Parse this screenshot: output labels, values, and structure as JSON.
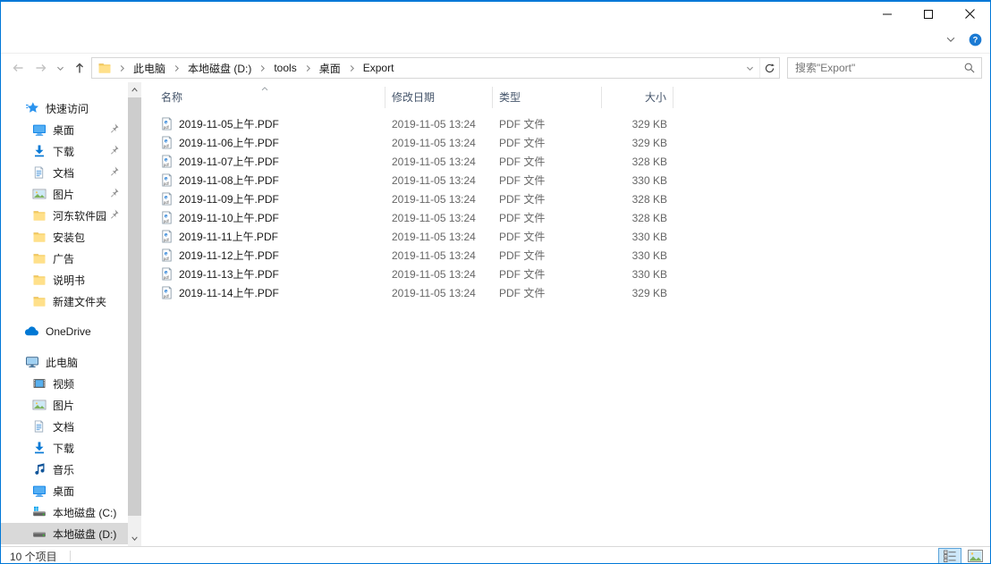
{
  "colors": {
    "accent": "#0078d7",
    "sidebar_selected": "#d9d9d9",
    "search_text": "#757575"
  },
  "titlebar": {
    "controls": [
      {
        "name": "minimize-button",
        "icon": "minimize-icon"
      },
      {
        "name": "maximize-button",
        "icon": "maximize-icon"
      },
      {
        "name": "close-button",
        "icon": "close-icon"
      }
    ]
  },
  "ribbon": {
    "buttons": [
      {
        "name": "ribbon-expand-button",
        "icon": "chevron-down-icon"
      },
      {
        "name": "help-button",
        "icon": "help-icon"
      }
    ]
  },
  "navbar": {
    "back_icon": "arrow-left-icon",
    "forward_icon": "arrow-right-icon",
    "recent_icon": "chevron-down-small-icon",
    "up_icon": "arrow-up-icon",
    "address": {
      "root_icon": "folder-icon",
      "segments": [
        "此电脑",
        "本地磁盘 (D:)",
        "tools",
        "桌面",
        "Export"
      ],
      "dropdown_icon": "chevron-down-small-icon",
      "refresh_icon": "refresh-icon"
    },
    "search": {
      "placeholder": "搜索\"Export\"",
      "icon": "search-icon"
    }
  },
  "sidebar": {
    "sections": [
      {
        "root": {
          "label": "快速访问",
          "icon": "quick-access-icon"
        },
        "children": [
          {
            "label": "桌面",
            "icon": "desktop-icon",
            "pinned": true
          },
          {
            "label": "下载",
            "icon": "download-icon",
            "pinned": true
          },
          {
            "label": "文档",
            "icon": "document-icon",
            "pinned": true
          },
          {
            "label": "图片",
            "icon": "picture-icon",
            "pinned": true
          },
          {
            "label": "河东软件园",
            "icon": "folder-icon",
            "pinned": true
          },
          {
            "label": "安装包",
            "icon": "folder-icon",
            "pinned": false
          },
          {
            "label": "广告",
            "icon": "folder-icon",
            "pinned": false
          },
          {
            "label": "说明书",
            "icon": "folder-icon",
            "pinned": false
          },
          {
            "label": "新建文件夹",
            "icon": "folder-icon",
            "pinned": false
          }
        ]
      },
      {
        "root": {
          "label": "OneDrive",
          "icon": "onedrive-icon"
        },
        "children": []
      },
      {
        "root": {
          "label": "此电脑",
          "icon": "this-pc-icon"
        },
        "children": [
          {
            "label": "视频",
            "icon": "video-icon"
          },
          {
            "label": "图片",
            "icon": "picture-icon"
          },
          {
            "label": "文档",
            "icon": "document-icon"
          },
          {
            "label": "下载",
            "icon": "download-icon"
          },
          {
            "label": "音乐",
            "icon": "music-icon"
          },
          {
            "label": "桌面",
            "icon": "desktop-icon"
          },
          {
            "label": "本地磁盘 (C:)",
            "icon": "drive-c-icon"
          },
          {
            "label": "本地磁盘 (D:)",
            "icon": "drive-d-icon",
            "selected": true
          }
        ]
      }
    ]
  },
  "filelist": {
    "columns": [
      "名称",
      "修改日期",
      "类型",
      "大小"
    ],
    "sort": {
      "column": "名称",
      "direction": "asc",
      "icon": "sort-asc-icon"
    },
    "file_icon": "pdf-file-icon",
    "rows": [
      {
        "name": "2019-11-05上午.PDF",
        "date": "2019-11-05 13:24",
        "type": "PDF 文件",
        "size": "329 KB"
      },
      {
        "name": "2019-11-06上午.PDF",
        "date": "2019-11-05 13:24",
        "type": "PDF 文件",
        "size": "329 KB"
      },
      {
        "name": "2019-11-07上午.PDF",
        "date": "2019-11-05 13:24",
        "type": "PDF 文件",
        "size": "328 KB"
      },
      {
        "name": "2019-11-08上午.PDF",
        "date": "2019-11-05 13:24",
        "type": "PDF 文件",
        "size": "330 KB"
      },
      {
        "name": "2019-11-09上午.PDF",
        "date": "2019-11-05 13:24",
        "type": "PDF 文件",
        "size": "328 KB"
      },
      {
        "name": "2019-11-10上午.PDF",
        "date": "2019-11-05 13:24",
        "type": "PDF 文件",
        "size": "328 KB"
      },
      {
        "name": "2019-11-11上午.PDF",
        "date": "2019-11-05 13:24",
        "type": "PDF 文件",
        "size": "330 KB"
      },
      {
        "name": "2019-11-12上午.PDF",
        "date": "2019-11-05 13:24",
        "type": "PDF 文件",
        "size": "330 KB"
      },
      {
        "name": "2019-11-13上午.PDF",
        "date": "2019-11-05 13:24",
        "type": "PDF 文件",
        "size": "330 KB"
      },
      {
        "name": "2019-11-14上午.PDF",
        "date": "2019-11-05 13:24",
        "type": "PDF 文件",
        "size": "329 KB"
      }
    ]
  },
  "statusbar": {
    "count": "10 个项目",
    "views": [
      {
        "name": "details-view-button",
        "icon": "details-view-icon",
        "selected": true
      },
      {
        "name": "thumbnails-view-button",
        "icon": "thumbnails-view-icon",
        "selected": false
      }
    ]
  }
}
